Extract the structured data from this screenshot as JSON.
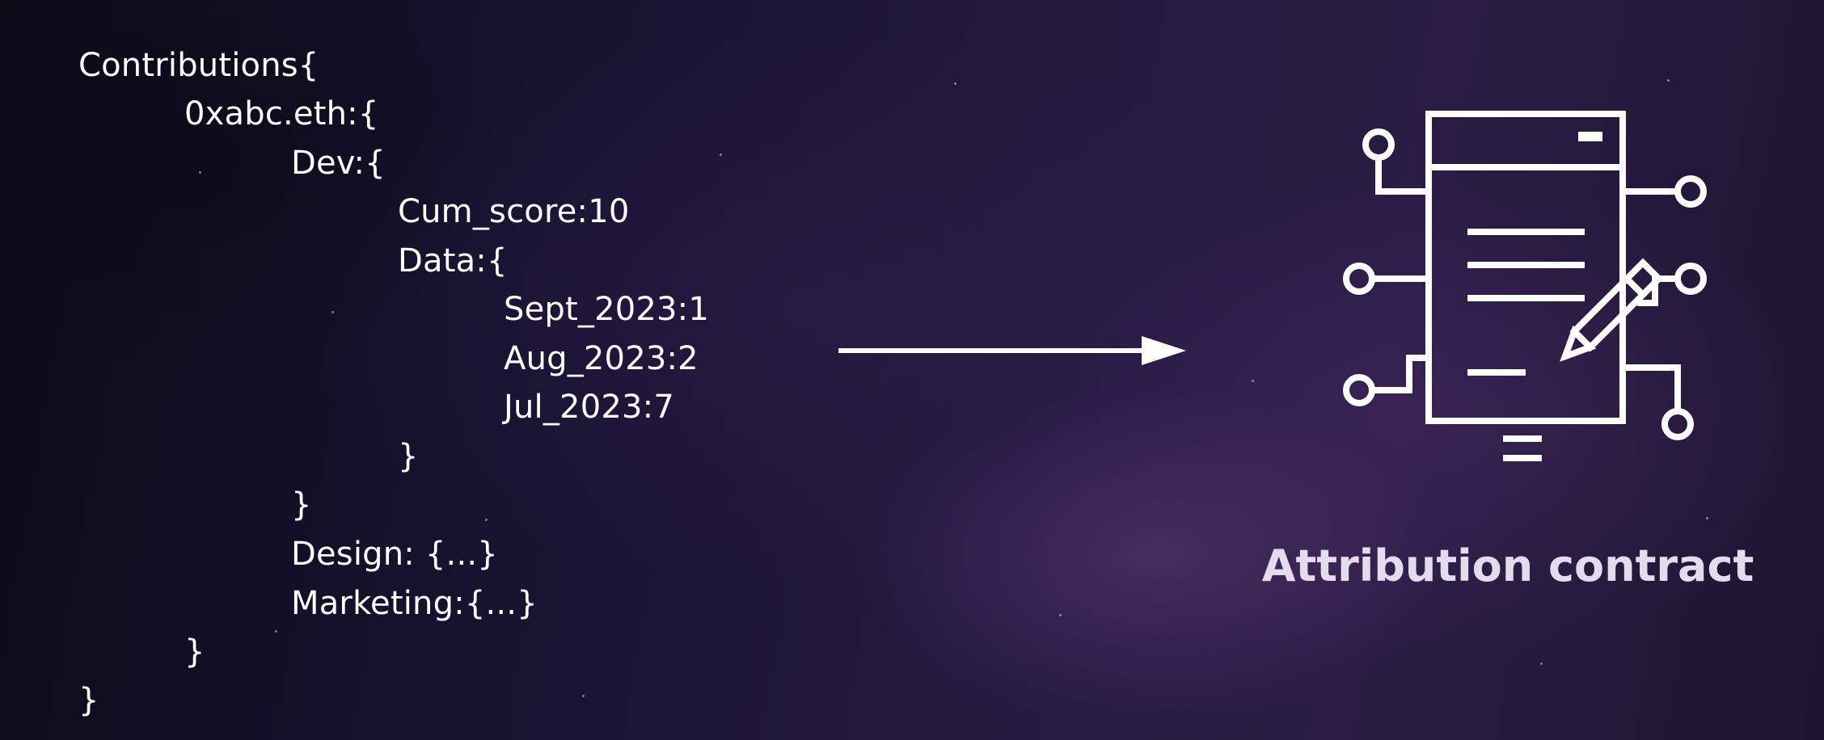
{
  "code": {
    "lines": [
      "Contributions{",
      "0xabc.eth:{",
      "Dev:{",
      "Cum_score:10",
      "Data:{",
      "Sept_2023:1",
      "Aug_2023:2",
      "Jul_2023:7",
      "}",
      "}",
      "Design: {...}",
      "Marketing:{...}",
      "}",
      "}"
    ]
  },
  "contract": {
    "caption": "Attribution contract",
    "icon": "smart-contract-document-icon"
  },
  "colors": {
    "text": "#ffffff",
    "caption": "#e2dced",
    "background": "#1a1530"
  }
}
